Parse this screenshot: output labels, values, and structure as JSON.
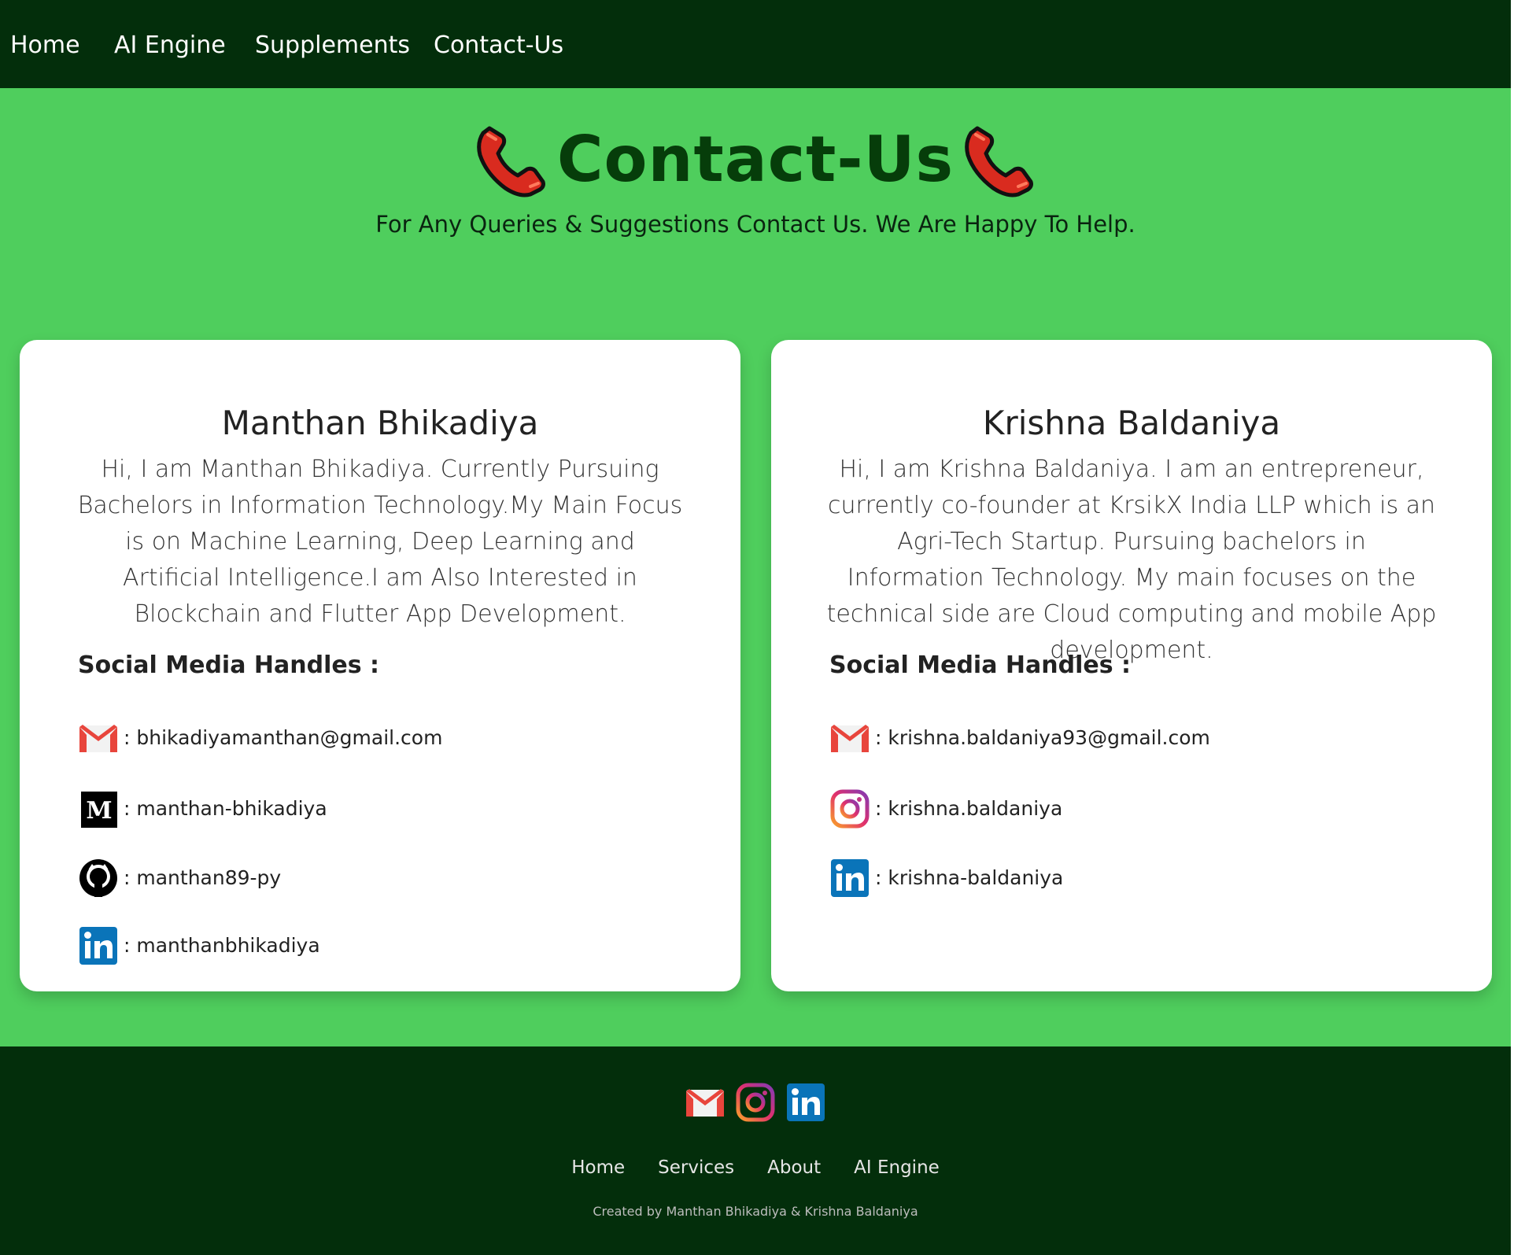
{
  "nav": {
    "items": [
      {
        "label": "Home"
      },
      {
        "label": "AI Engine"
      },
      {
        "label": "Supplements"
      },
      {
        "label": "Contact-Us"
      }
    ]
  },
  "hero": {
    "title": "Contact-Us",
    "subtitle": "For Any Queries & Suggestions Contact Us. We Are Happy To Help.",
    "icon": "telephone-receiver-icon"
  },
  "cards": [
    {
      "name": "Manthan Bhikadiya",
      "bio": "Hi, I am Manthan Bhikadiya. Currently Pursuing Bachelors in Information Technology.My Main Focus is on Machine Learning, Deep Learning and Artificial Intelligence.I am Also Interested in Blockchain and Flutter App Development.",
      "handles_title": "Social Media Handles :",
      "handles": [
        {
          "icon": "gmail-icon",
          "text": ": bhikadiyamanthan@gmail.com"
        },
        {
          "icon": "medium-icon",
          "text": ": manthan-bhikadiya"
        },
        {
          "icon": "github-icon",
          "text": ": manthan89-py"
        },
        {
          "icon": "linkedin-icon",
          "text": ": manthanbhikadiya"
        }
      ]
    },
    {
      "name": "Krishna Baldaniya",
      "bio": "Hi, I am Krishna Baldaniya. I am an entrepreneur, currently co-founder at KrsikX India LLP which is an Agri-Tech Startup. Pursuing bachelors in Information Technology. My main focuses on the technical side are Cloud computing and mobile App development.",
      "handles_title": "Social Media Handles :",
      "handles": [
        {
          "icon": "gmail-icon",
          "text": ": krishna.baldaniya93@gmail.com"
        },
        {
          "icon": "instagram-icon",
          "text": ": krishna.baldaniya"
        },
        {
          "icon": "linkedin-icon",
          "text": ": krishna-baldaniya"
        }
      ]
    }
  ],
  "footer": {
    "icons": [
      "gmail-icon",
      "instagram-icon",
      "linkedin-icon"
    ],
    "links": [
      {
        "label": "Home"
      },
      {
        "label": "Services"
      },
      {
        "label": "About"
      },
      {
        "label": "AI Engine"
      }
    ],
    "credit": "Created by Manthan Bhikadiya & Krishna Baldaniya"
  },
  "colors": {
    "navbar_bg": "#032e0b",
    "page_bg": "#4fce5d",
    "title": "#063d0a",
    "card_bg": "#ffffff"
  }
}
